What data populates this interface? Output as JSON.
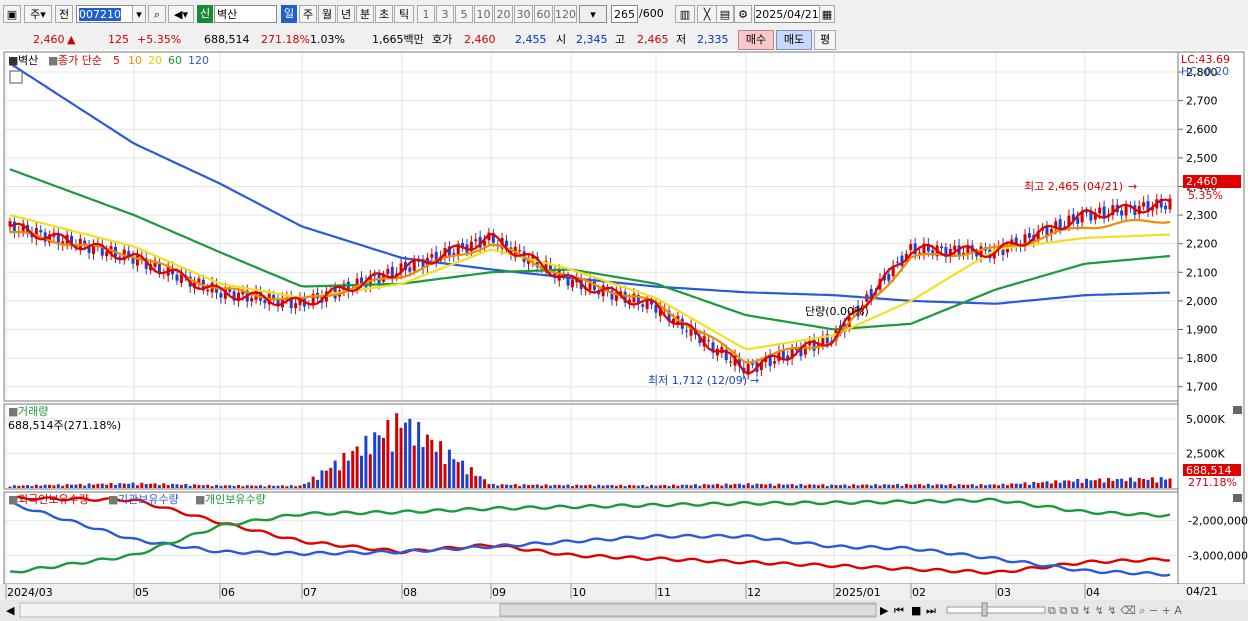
{
  "toolbar": {
    "market": "주",
    "prev": "전",
    "code": "007210",
    "badge": "신",
    "name": "벽산",
    "periods": [
      "일",
      "주",
      "월",
      "년",
      "분",
      "초",
      "틱"
    ],
    "minutes": [
      "1",
      "3",
      "5",
      "10",
      "20",
      "30",
      "60",
      "120"
    ],
    "count": "265",
    "count_total": "/600",
    "date": "2025/04/21"
  },
  "price_row": {
    "price": "2,460",
    "arrow": "▲",
    "change": "125",
    "change_pct": "+5.35%",
    "volume": "688,514",
    "volume_ratio": "271.18%",
    "turnover": "1.03%",
    "amount": "1,665백만",
    "quote_label": "호가",
    "ask": "2,460",
    "bid": "2,455",
    "open_label": "시",
    "open": "2,345",
    "high_label": "고",
    "high": "2,465",
    "low_label": "저",
    "low": "2,335",
    "buy": "매수",
    "sell": "매도",
    "eval": "평"
  },
  "legend": {
    "stock": "벽산",
    "ma_label": "종가 단순",
    "ma_periods": [
      "5",
      "10",
      "20",
      "60",
      "120"
    ],
    "volume_title": "거래량",
    "volume_value": "688,514주(271.18%)",
    "holdings": [
      "외국인보유수량",
      "기관보유수량",
      "개인보유수량"
    ]
  },
  "axis": {
    "lc": "LC:43.69",
    "hc": "HC:-0.20",
    "last_price": "2,460",
    "last_pct": "5.35%",
    "vol_last": "688,514",
    "vol_pct": "271.18%",
    "right_date": "04/21"
  },
  "annotations": {
    "high": "최고 2,465 (04/21)",
    "low": "최저 1,712 (12/09)",
    "vi": "단량(0.00%)"
  },
  "colors": {
    "ma5": "#e00000",
    "ma10": "#f08c00",
    "ma20": "#f0e020",
    "ma60": "#1a9a3a",
    "ma120": "#2a5ad8",
    "up": "#d20000",
    "down": "#1f3fd0",
    "foreign": "#e00000",
    "institution": "#2a5ad8",
    "individual": "#1a9a3a"
  },
  "chart_data": [
    {
      "type": "line",
      "title": "벽산",
      "x": [
        "2024/03",
        "05",
        "06",
        "07",
        "08",
        "09",
        "10",
        "11",
        "12",
        "2025/01",
        "02",
        "03",
        "04"
      ],
      "y_ticks": [
        "1,700",
        "1,800",
        "1,900",
        "2,000",
        "2,100",
        "2,200",
        "2,300",
        "2,400",
        "2,500",
        "2,600",
        "2,700",
        "2,800"
      ],
      "ylim": [
        1650,
        2870
      ],
      "series": [
        {
          "name": "5",
          "values": [
            2260,
            2150,
            2030,
            1990,
            2110,
            2220,
            2070,
            1980,
            1760,
            1870,
            2180,
            2170,
            2300
          ]
        },
        {
          "name": "10",
          "values": [
            2240,
            2160,
            2040,
            2000,
            2090,
            2200,
            2080,
            1990,
            1790,
            1860,
            2150,
            2180,
            2260
          ]
        },
        {
          "name": "20",
          "values": [
            2300,
            2190,
            2060,
            2010,
            2060,
            2180,
            2110,
            2010,
            1830,
            1880,
            2000,
            2180,
            2220
          ]
        },
        {
          "name": "60",
          "values": [
            2460,
            2300,
            2170,
            2050,
            2060,
            2100,
            2110,
            2060,
            1950,
            1900,
            1920,
            2040,
            2130
          ]
        },
        {
          "name": "120",
          "values": [
            2830,
            2550,
            2410,
            2260,
            2150,
            2110,
            2080,
            2050,
            2030,
            2020,
            2000,
            1990,
            2020
          ]
        }
      ]
    },
    {
      "type": "bar",
      "title": "거래량",
      "y_ticks": [
        "2,500K",
        "5,000K"
      ],
      "ylim": [
        0,
        6000000
      ],
      "values": [
        200000,
        400000,
        220000,
        200000,
        5800000,
        300000,
        250000,
        220000,
        350000,
        260000,
        300000,
        280000,
        688514
      ]
    },
    {
      "type": "line",
      "y_ticks": [
        "-2,000,000",
        "-3,000,000"
      ],
      "series": [
        {
          "name": "외국인보유수량",
          "values": [
            -1350000,
            -1400000,
            -2050000,
            -2600000,
            -2900000,
            -2700000,
            -3000000,
            -3100000,
            -3200000,
            -3300000,
            -3400000,
            -3500000,
            -3200000
          ]
        },
        {
          "name": "기관보유수량",
          "values": [
            -1500000,
            -2550000,
            -2900000,
            -2950000,
            -2900000,
            -2750000,
            -2600000,
            -2450000,
            -2450000,
            -2750000,
            -2800000,
            -3100000,
            -3450000
          ]
        },
        {
          "name": "개인보유수량",
          "values": [
            -3500000,
            -3000000,
            -2150000,
            -1800000,
            -1750000,
            -1650000,
            -1600000,
            -1550000,
            -1500000,
            -1480000,
            -1450000,
            -1400000,
            -1750000
          ]
        }
      ]
    }
  ]
}
